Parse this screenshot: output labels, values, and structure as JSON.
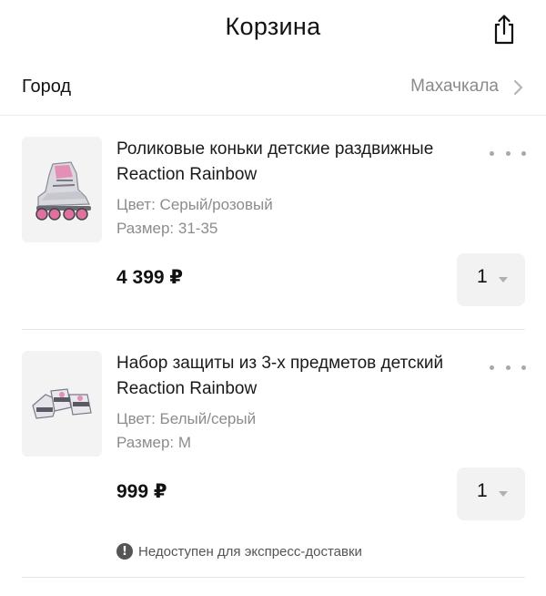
{
  "header": {
    "title": "Корзина",
    "share_icon": "share-icon"
  },
  "city": {
    "label": "Город",
    "value": "Махачкала",
    "chevron_icon": "chevron-right-icon"
  },
  "cart_items": [
    {
      "name": "Роликовые коньки детские раздвижные Reaction Rainbow",
      "color": "Цвет: Серый/розовый",
      "size": "Размер: 31-35",
      "price": "4 399 ₽",
      "quantity": "1",
      "image": "inline-skates-image",
      "more_icon": "more-dots-icon"
    },
    {
      "name": "Набор защиты из 3-х предметов детский Reaction Rainbow",
      "color": "Цвет: Белый/серый",
      "size": "Размер: M",
      "price": "999 ₽",
      "quantity": "1",
      "image": "protection-set-image",
      "more_icon": "more-dots-icon",
      "notice": "Недоступен для экспресс-доставки",
      "notice_icon": "exclamation-circle-icon"
    }
  ]
}
